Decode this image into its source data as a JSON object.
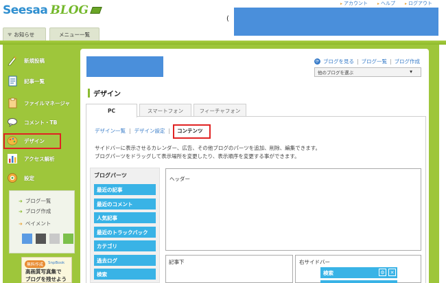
{
  "logo": {
    "main": "Seesaa",
    "blog": "BLOG"
  },
  "top_links": [
    "アカウント",
    "ヘルプ",
    "ログアウト"
  ],
  "top_tabs": [
    "お知らせ",
    "メニュー一覧"
  ],
  "sidebar": {
    "items": [
      {
        "label": "新規投稿",
        "icon": "pen-icon"
      },
      {
        "label": "記事一覧",
        "icon": "document-icon"
      },
      {
        "label": "ファイルマネージャ",
        "icon": "clipboard-icon"
      },
      {
        "label": "コメント・TB",
        "icon": "speech-bubble-icon"
      },
      {
        "label": "デザイン",
        "icon": "palette-icon"
      },
      {
        "label": "アクセス解析",
        "icon": "bar-chart-icon"
      },
      {
        "label": "設定",
        "icon": "gear-icon"
      }
    ],
    "selected": "デザイン",
    "sub_links": [
      "ブログ一覧",
      "ブログ作成",
      "ペイメント"
    ],
    "swatches": [
      "#5b9be3",
      "#555555",
      "#c9c9c9",
      "#7cc04b"
    ],
    "banner": {
      "badge": "無料作成",
      "brand": "SnpBook",
      "line1": "高画質写真集で",
      "line2": "ブログを残せよう"
    }
  },
  "blog_links": {
    "view": "ブログを見る",
    "list": "ブログ一覧",
    "create": "ブログ作成"
  },
  "blog_select": {
    "value": "他のブログを選ぶ"
  },
  "page_title": "デザイン",
  "device_tabs": [
    {
      "label": "PC",
      "active": true
    },
    {
      "label": "スマートフォン",
      "active": false
    },
    {
      "label": "フィーチャフォン",
      "active": false
    }
  ],
  "sub_nav": {
    "list": "デザイン一覧",
    "settings": "デザイン設定",
    "current": "コンテンツ"
  },
  "description": [
    "サイドバーに表示させるカレンダー、広告、その他ブログのパーツを追加、削除、編集できます。",
    "ブログパーツをドラッグして表示場所を変更したり、表示順序を変更する事ができます。"
  ],
  "parts": {
    "title": "ブログパーツ",
    "items": [
      "最近の記事",
      "最近のコメント",
      "人気記事",
      "最近のトラックバック",
      "カテゴリ",
      "過去ログ",
      "検索"
    ]
  },
  "slots": {
    "header": "ヘッダー",
    "article_bottom": "記事下",
    "right_sidebar": "右サイドバー"
  },
  "right_widgets": [
    "検索"
  ],
  "colors": {
    "accent_green": "#9ec63b",
    "part_blue": "#39b3e6",
    "highlight_red": "#e02222"
  }
}
